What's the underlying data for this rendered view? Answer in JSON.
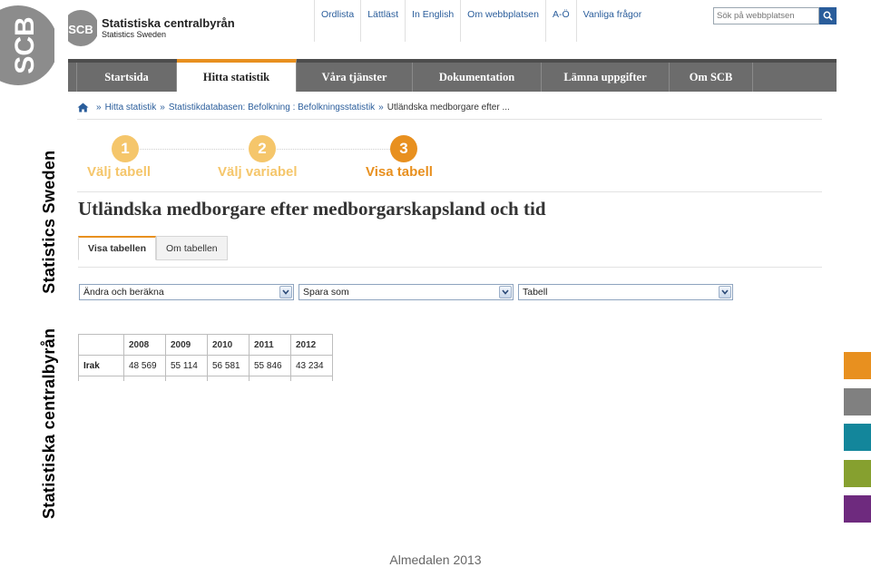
{
  "slide": {
    "vertical_text_1": "Statistiska centralbyrån",
    "vertical_text_2": "Statistics Sweden",
    "logo_text": "SCB",
    "footer": "Almedalen 2013",
    "tab_colors": [
      "#e8901f",
      "#808080",
      "#13869b",
      "#86a02f",
      "#6e2a7e"
    ]
  },
  "site": {
    "logo_text": "SCB",
    "brand_name": "Statistiska centralbyrån",
    "brand_sub": "Statistics Sweden",
    "top_links": [
      "Ordlista",
      "Lättläst",
      "In English",
      "Om webbplatsen",
      "A-Ö",
      "Vanliga frågor"
    ],
    "search_placeholder": "Sök på webbplatsen",
    "nav": [
      {
        "label": "Startsida",
        "active": false
      },
      {
        "label": "Hitta statistik",
        "active": true
      },
      {
        "label": "Våra tjänster",
        "active": false
      },
      {
        "label": "Dokumentation",
        "active": false
      },
      {
        "label": "Lämna uppgifter",
        "active": false
      },
      {
        "label": "Om SCB",
        "active": false
      }
    ],
    "breadcrumb": {
      "items": [
        "Hitta statistik",
        "Statistikdatabasen: Befolkning : Befolkningsstatistik"
      ],
      "current": "Utländska medborgare efter ..."
    },
    "steps": [
      {
        "number": "1",
        "label": "Välj tabell",
        "state": "done"
      },
      {
        "number": "2",
        "label": "Välj variabel",
        "state": "done"
      },
      {
        "number": "3",
        "label": "Visa tabell",
        "state": "current"
      }
    ],
    "page_title": "Utländska medborgare efter medborgarskapsland och tid",
    "tabs": [
      {
        "label": "Visa tabellen",
        "active": true
      },
      {
        "label": "Om tabellen",
        "active": false
      }
    ],
    "selects": [
      "Ändra och beräkna",
      "Spara som",
      "Tabell"
    ],
    "table": {
      "headers": [
        "2008",
        "2009",
        "2010",
        "2011",
        "2012"
      ],
      "rows": [
        {
          "label": "Irak",
          "values": [
            "48 569",
            "55 114",
            "56 581",
            "55 846",
            "43 234"
          ]
        }
      ]
    }
  },
  "colors": {
    "accent_orange": "#e8901f",
    "step_done": "#f5c66b",
    "link_blue": "#2a5d9b",
    "nav_gray": "#6c6c6c"
  }
}
